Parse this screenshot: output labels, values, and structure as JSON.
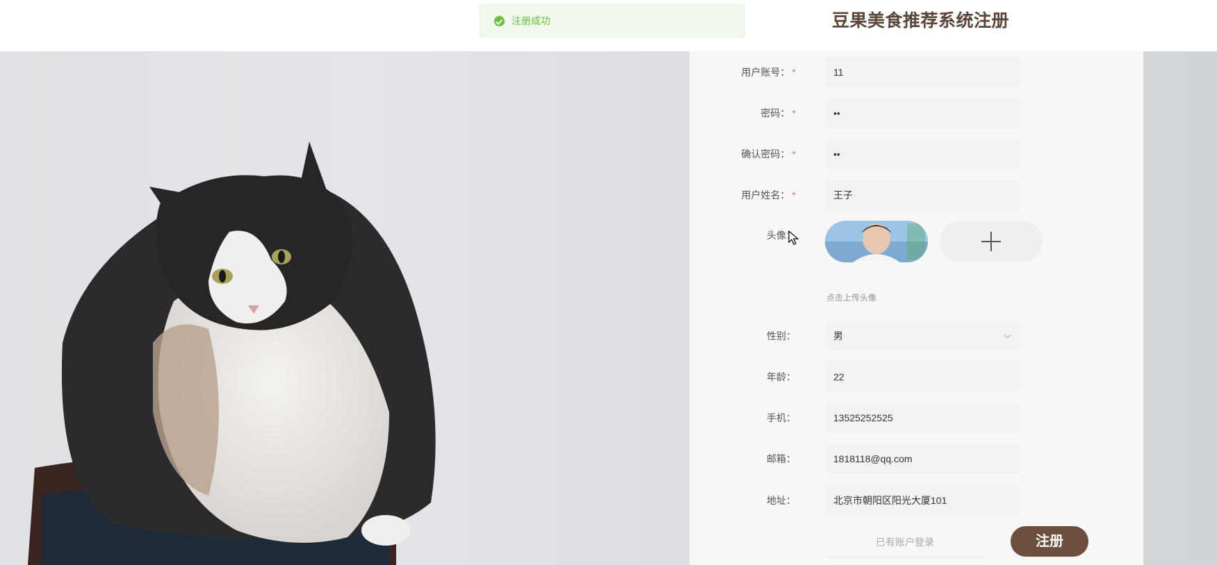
{
  "header": {
    "title": "豆果美食推荐系统注册"
  },
  "toast": {
    "message": "注册成功",
    "icon": "check-circle-icon",
    "color": "#67c23a"
  },
  "form": {
    "account": {
      "label": "用户账号：",
      "required": "*",
      "value": "11"
    },
    "password": {
      "label": "密码：",
      "required": "*",
      "value": "••"
    },
    "confirm_password": {
      "label": "确认密码：",
      "required": "*",
      "value": "••"
    },
    "name": {
      "label": "用户姓名：",
      "required": "*",
      "value": "王子"
    },
    "avatar": {
      "label": "头像：",
      "hint": "点击上传头像",
      "upload_icon": "plus-icon"
    },
    "gender": {
      "label": "性别：",
      "value": "男"
    },
    "age": {
      "label": "年龄：",
      "value": "22"
    },
    "phone": {
      "label": "手机：",
      "value": "13525252525"
    },
    "email": {
      "label": "邮箱：",
      "value": "1818118@qq.com"
    },
    "address": {
      "label": "地址：",
      "value": "北京市朝阳区阳光大厦101"
    }
  },
  "actions": {
    "login_link": "已有账户登录",
    "register_button": "注册"
  },
  "colors": {
    "brand": "#6b4e3d",
    "required": "#f56c6c"
  }
}
